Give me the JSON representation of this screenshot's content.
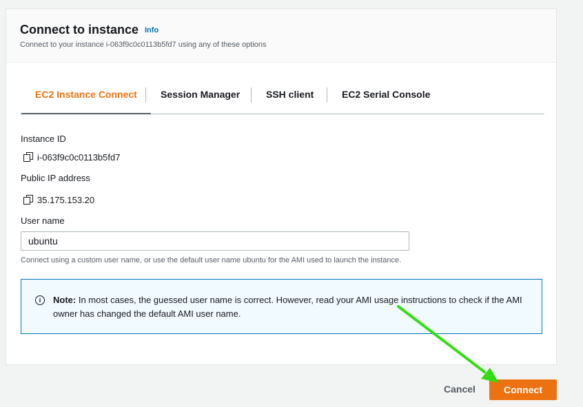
{
  "header": {
    "title": "Connect to instance",
    "info_label": "Info",
    "subtitle": "Connect to your instance i-063f9c0c0113b5fd7 using any of these options"
  },
  "tabs": [
    {
      "label": "EC2 Instance Connect",
      "active": true
    },
    {
      "label": "Session Manager",
      "active": false
    },
    {
      "label": "SSH client",
      "active": false
    },
    {
      "label": "EC2 Serial Console",
      "active": false
    }
  ],
  "fields": {
    "instance_id_label": "Instance ID",
    "instance_id_value": "i-063f9c0c0113b5fd7",
    "public_ip_label": "Public IP address",
    "public_ip_value": "35.175.153.20",
    "username_label": "User name",
    "username_value": "ubuntu",
    "username_hint": "Connect using a custom user name, or use the default user name ubuntu for the AMI used to launch the instance."
  },
  "alert": {
    "prefix": "Note:",
    "text": " In most cases, the guessed user name is correct. However, read your AMI usage instructions to check if the AMI owner has changed the default AMI user name."
  },
  "footer": {
    "cancel_label": "Cancel",
    "connect_label": "Connect"
  },
  "colors": {
    "accent": "#ec7211",
    "link": "#0073bb",
    "annotation_arrow": "#33dd11"
  },
  "icons": [
    "copy-icon",
    "info-circle-icon",
    "annotation-arrow"
  ]
}
